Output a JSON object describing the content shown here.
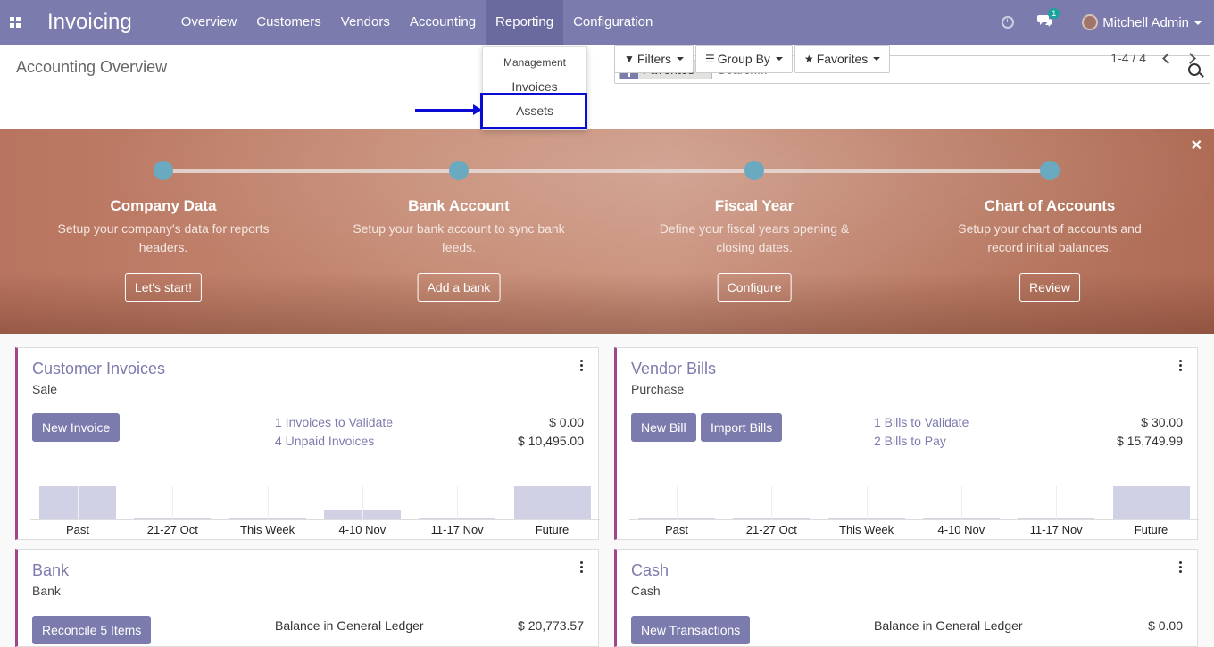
{
  "navbar": {
    "app_name": "Invoicing",
    "menu": [
      "Overview",
      "Customers",
      "Vendors",
      "Accounting",
      "Reporting",
      "Configuration"
    ],
    "active_menu": "Reporting",
    "chat_count": "1",
    "user": "Mitchell Admin",
    "accent": "#7c7bad"
  },
  "page": {
    "title": "Accounting Overview"
  },
  "search": {
    "facet": "Favorites",
    "placeholder": "Search...",
    "filters_label": "Filters",
    "groupby_label": "Group By",
    "favorites_label": "Favorites"
  },
  "pager": {
    "value": "1-4 / 4"
  },
  "reporting_dropdown": {
    "section": "Management",
    "items": [
      "Invoices",
      "Assets"
    ],
    "highlighted": "Assets"
  },
  "onboarding": {
    "steps": [
      {
        "title": "Company Data",
        "desc": "Setup your company's data for reports headers.",
        "button": "Let's start!"
      },
      {
        "title": "Bank Account",
        "desc": "Setup your bank account to sync bank feeds.",
        "button": "Add a bank"
      },
      {
        "title": "Fiscal Year",
        "desc": "Define your fiscal years opening & closing dates.",
        "button": "Configure"
      },
      {
        "title": "Chart of Accounts",
        "desc": "Setup your chart of accounts and record initial balances.",
        "button": "Review"
      }
    ]
  },
  "journals": {
    "customer_invoices": {
      "title": "Customer Invoices",
      "type": "Sale",
      "button": "New Invoice",
      "stats": [
        {
          "label": "1 Invoices to Validate",
          "amount": "$ 0.00"
        },
        {
          "label": "4 Unpaid Invoices",
          "amount": "$ 10,495.00"
        }
      ],
      "graph_labels": [
        "Past",
        "21-27 Oct",
        "This Week",
        "4-10 Nov",
        "11-17 Nov",
        "Future"
      ],
      "graph_levels": [
        1.0,
        0.05,
        0.05,
        0.28,
        0.05,
        1.0
      ]
    },
    "vendor_bills": {
      "title": "Vendor Bills",
      "type": "Purchase",
      "button": "New Bill",
      "button2": "Import Bills",
      "stats": [
        {
          "label": "1 Bills to Validate",
          "amount": "$ 30.00"
        },
        {
          "label": "2 Bills to Pay",
          "amount": "$ 15,749.99"
        }
      ],
      "graph_labels": [
        "Past",
        "21-27 Oct",
        "This Week",
        "4-10 Nov",
        "11-17 Nov",
        "Future"
      ],
      "graph_levels": [
        0.05,
        0.05,
        0.05,
        0.05,
        0.05,
        1.0
      ]
    },
    "bank": {
      "title": "Bank",
      "type": "Bank",
      "button": "Reconcile 5 Items",
      "balance_label": "Balance in General Ledger",
      "balance": "$ 20,773.57"
    },
    "cash": {
      "title": "Cash",
      "type": "Cash",
      "button": "New Transactions",
      "balance_label": "Balance in General Ledger",
      "balance": "$ 0.00"
    }
  }
}
